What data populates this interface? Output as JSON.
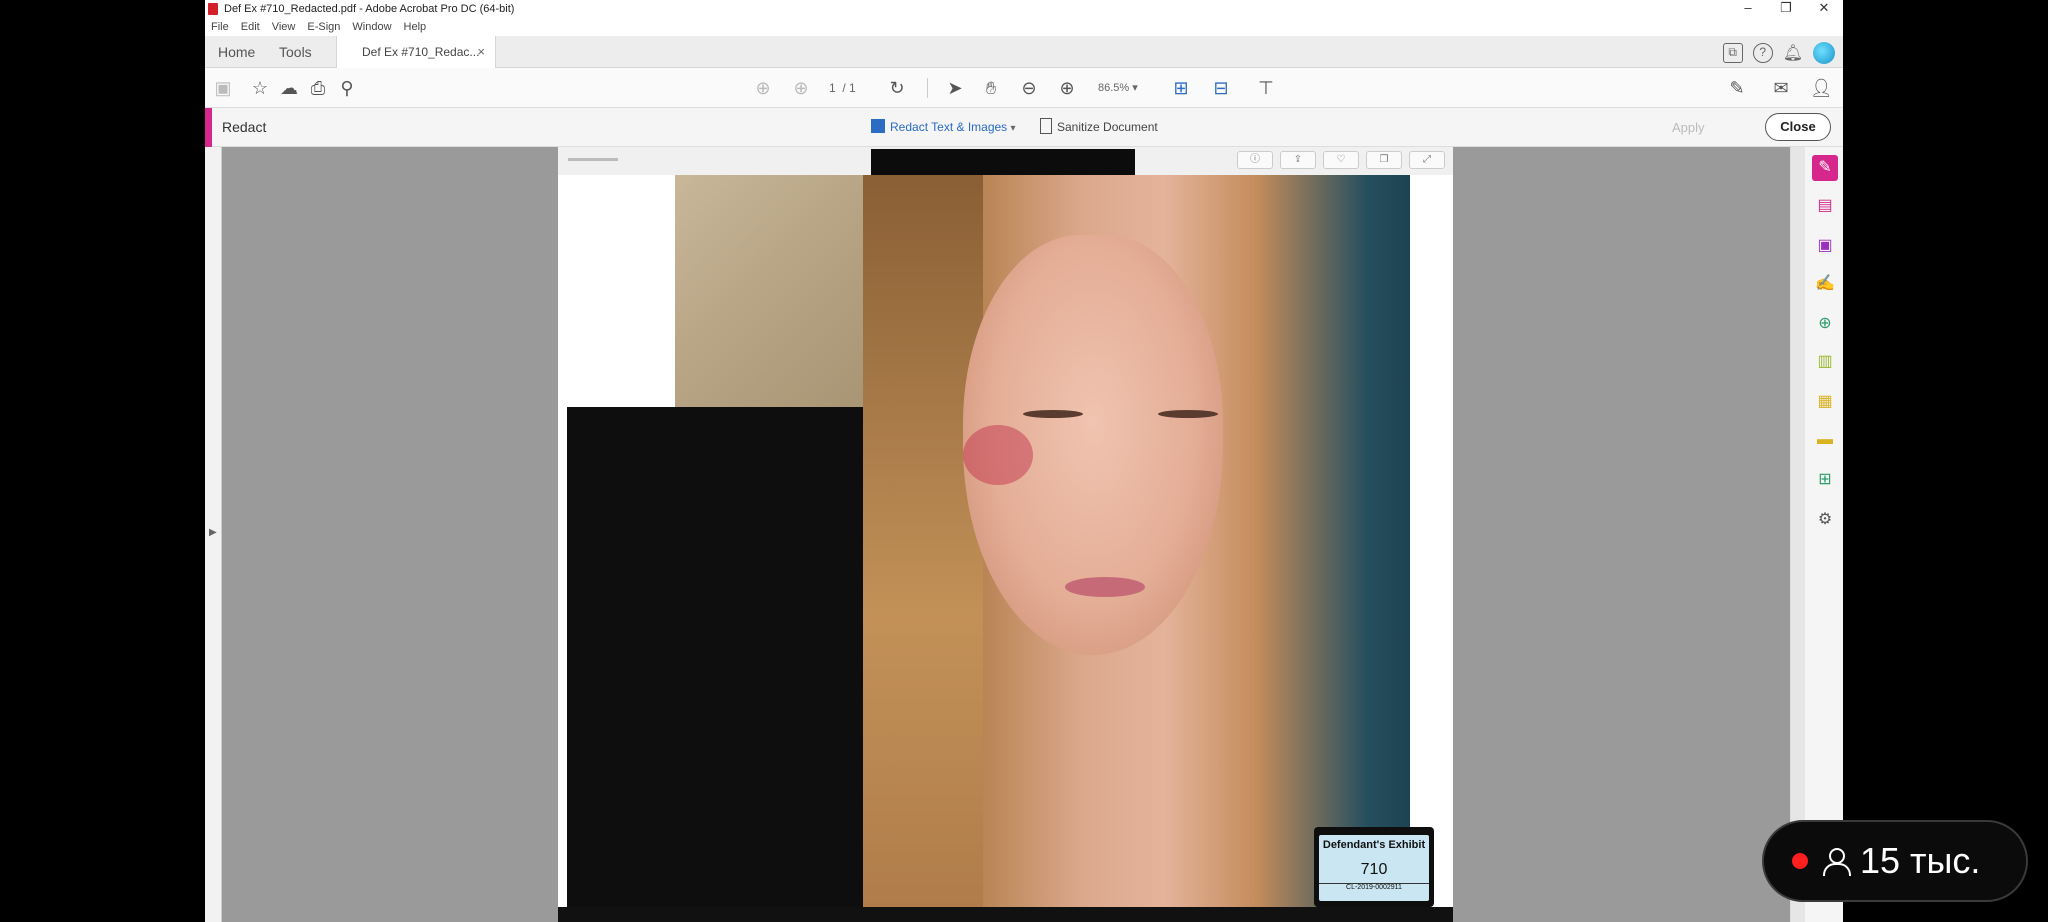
{
  "window": {
    "title": "Def Ex #710_Redacted.pdf - Adobe Acrobat Pro DC (64-bit)",
    "minimize": "–",
    "maximize": "❐",
    "close": "✕"
  },
  "menu": [
    "File",
    "Edit",
    "View",
    "E-Sign",
    "Window",
    "Help"
  ],
  "tabs": {
    "home": "Home",
    "tools": "Tools",
    "document": "Def Ex #710_Redac...",
    "document_close": "×"
  },
  "toolbar": {
    "page_current": "1",
    "page_total": "/ 1",
    "zoom": "86.5%"
  },
  "redact": {
    "title": "Redact",
    "redact_text_images": "Redact Text & Images",
    "sanitize_document": "Sanitize Document",
    "apply": "Apply",
    "close": "Close"
  },
  "exhibit": {
    "label": "Defendant's Exhibit",
    "number": "710",
    "case": "CL-2019-0002911"
  },
  "live": {
    "viewers": "15 тыс."
  },
  "colors": {
    "accent": "#d6278c",
    "link": "#2b6cc4",
    "live_dot": "#ff1f1f"
  }
}
